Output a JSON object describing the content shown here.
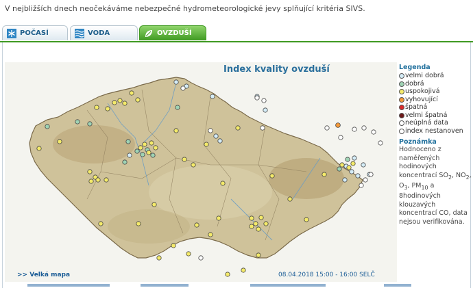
{
  "notice": "V nejbližších dnech neočekáváme nebezpečné hydrometeorologické jevy splňující kritéria SIVS.",
  "tabs": [
    {
      "label": "POČASÍ",
      "icon": "snowflake-icon",
      "active": false
    },
    {
      "label": "VODA",
      "icon": "waves-icon",
      "active": false
    },
    {
      "label": "OVZDUŠÍ",
      "icon": "leaf-icon",
      "active": true
    }
  ],
  "map": {
    "title": "Index kvality ovzduší",
    "big_map_link": ">> Velká mapa",
    "timestamp": "08.04.2018 15:00 - 16:00 SELČ"
  },
  "legend": {
    "title": "Legenda",
    "items": [
      {
        "label": "velmi dobrá",
        "color": "#d4ecf7"
      },
      {
        "label": "dobrá",
        "color": "#9fd3b4"
      },
      {
        "label": "uspokojivá",
        "color": "#f4ea6a"
      },
      {
        "label": "vyhovující",
        "color": "#f59a3a"
      },
      {
        "label": "špatná",
        "color": "#d92b2b"
      },
      {
        "label": "velmi špatná",
        "color": "#6e1a1a"
      },
      {
        "label": "neúplná data",
        "color": "#ffffff"
      },
      {
        "label": "index nestanoven",
        "color": "#ffffff"
      }
    ]
  },
  "note": {
    "title": "Poznámka",
    "text_html": "Hodnoceno z naměřených hodinových koncentrací SO<sub>2</sub>, NO<sub>2</sub>, O<sub>3</sub>, PM<sub>10</sub> a 8hodinových klouzavých koncentrací CO, data nejsou verifikována."
  },
  "colors": {
    "accent": "#3f9a22",
    "link": "#1a5c96"
  }
}
